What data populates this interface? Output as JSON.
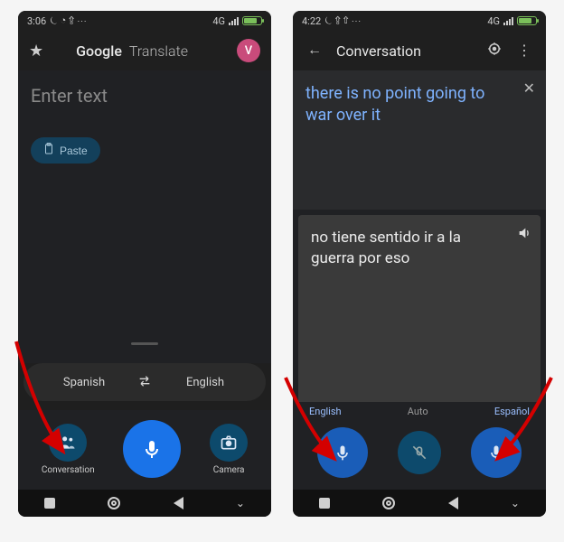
{
  "left": {
    "status": {
      "time": "3:06",
      "icons": "⏾ ◔ ⇪ ⋯",
      "net": "4G"
    },
    "header": {
      "title_brand": "Google",
      "title_app": "Translate",
      "avatar_initial": "V"
    },
    "placeholder": "Enter text",
    "paste_label": "Paste",
    "lang_from": "Spanish",
    "lang_to": "English",
    "action_conversation": "Conversation",
    "action_camera": "Camera"
  },
  "right": {
    "status": {
      "time": "4:22",
      "icons": "⏾ ⇪ ⇧ ⋯",
      "net": "4G"
    },
    "header": {
      "title": "Conversation"
    },
    "source_text": "there is no point going to war over it",
    "target_text": "no tiene sentido ir a la guerra por eso",
    "lang_left": "English",
    "lang_mid": "Auto",
    "lang_right": "Español"
  }
}
